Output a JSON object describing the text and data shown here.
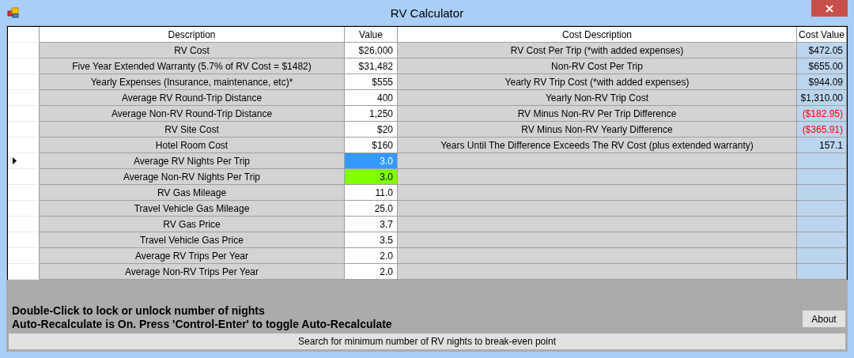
{
  "window": {
    "title": "RV Calculator"
  },
  "table": {
    "columns": [
      "Description",
      "Value",
      "Cost Description",
      "Cost Value"
    ],
    "inputs": [
      {
        "description": "RV Cost",
        "value": "$26,000",
        "selected": false,
        "locked": false
      },
      {
        "description": "Five Year Extended Warranty (5.7% of RV Cost = $1482)",
        "value": "$31,482",
        "selected": false,
        "locked": false
      },
      {
        "description": "Yearly Expenses (Insurance, maintenance, etc)*",
        "value": "$555",
        "selected": false,
        "locked": false
      },
      {
        "description": "Average RV Round-Trip Distance",
        "value": "400",
        "selected": false,
        "locked": false
      },
      {
        "description": "Average Non-RV Round-Trip Distance",
        "value": "1,250",
        "selected": false,
        "locked": false
      },
      {
        "description": "RV Site Cost",
        "value": "$20",
        "selected": false,
        "locked": false
      },
      {
        "description": "Hotel Room Cost",
        "value": "$160",
        "selected": false,
        "locked": false
      },
      {
        "description": "Average RV Nights Per Trip",
        "value": "3.0",
        "selected": true,
        "locked": false
      },
      {
        "description": "Average Non-RV Nights Per Trip",
        "value": "3.0",
        "selected": false,
        "locked": true
      },
      {
        "description": "RV Gas Mileage",
        "value": "11.0",
        "selected": false,
        "locked": false
      },
      {
        "description": "Travel Vehicle Gas Mileage",
        "value": "25.0",
        "selected": false,
        "locked": false
      },
      {
        "description": "RV Gas Price",
        "value": "3.7",
        "selected": false,
        "locked": false
      },
      {
        "description": "Travel Vehicle Gas Price",
        "value": "3.5",
        "selected": false,
        "locked": false
      },
      {
        "description": "Average RV Trips Per Year",
        "value": "2.0",
        "selected": false,
        "locked": false
      },
      {
        "description": "Average Non-RV Trips Per Year",
        "value": "2.0",
        "selected": false,
        "locked": false
      }
    ],
    "costs": [
      {
        "description": "RV Cost Per Trip (*with added expenses)",
        "value": "$472.05",
        "negative": false
      },
      {
        "description": "Non-RV Cost Per Trip",
        "value": "$655.00",
        "negative": false
      },
      {
        "description": "Yearly RV Trip Cost (*with added expenses)",
        "value": "$944.09",
        "negative": false
      },
      {
        "description": "Yearly Non-RV Trip Cost",
        "value": "$1,310.00",
        "negative": false
      },
      {
        "description": "RV Minus Non-RV Per Trip Difference",
        "value": "($182.95)",
        "negative": true
      },
      {
        "description": "RV Minus Non-RV Yearly Difference",
        "value": "($365.91)",
        "negative": true
      },
      {
        "description": "Years Until The Difference Exceeds The RV Cost (plus extended warranty)",
        "value": "157.1",
        "negative": false
      }
    ]
  },
  "notes": [
    "Double-Click to lock or unlock number of nights",
    "Auto-Recalculate is On. Press 'Control-Enter' to toggle Auto-Recalculate"
  ],
  "about_button": "About",
  "search_button": "Search for minimum number of RV nights to break-even point"
}
